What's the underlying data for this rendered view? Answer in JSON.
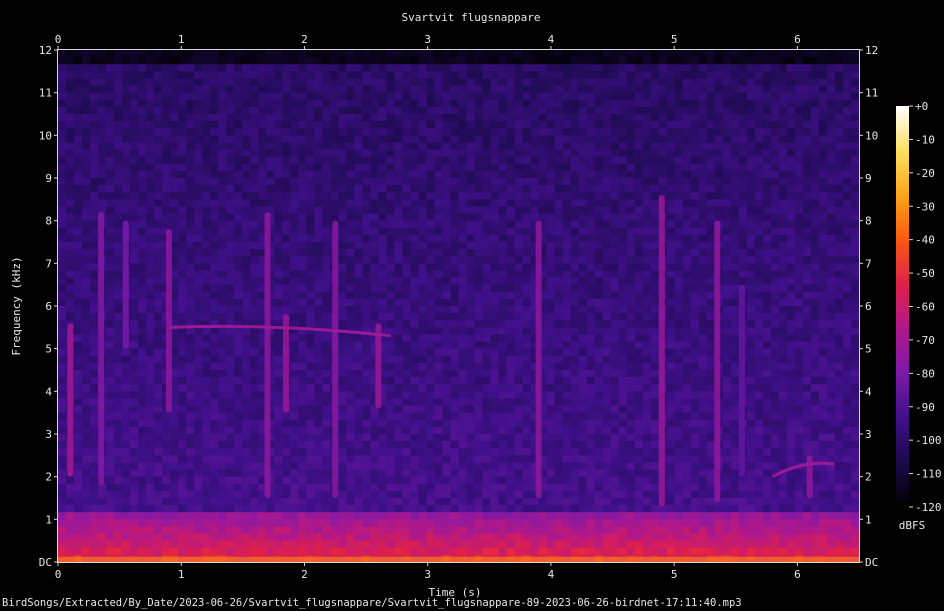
{
  "chart_data": {
    "type": "heatmap",
    "title": "Svartvit flugsnappare",
    "xlabel": "Time (s)",
    "ylabel": "Frequency (kHz)",
    "xlim": [
      0,
      6.5
    ],
    "ylim": [
      0,
      12
    ],
    "x_ticks": [
      "0",
      "1",
      "2",
      "3",
      "4",
      "5",
      "6"
    ],
    "y_ticks": [
      "DC",
      "1",
      "2",
      "3",
      "4",
      "5",
      "6",
      "7",
      "8",
      "9",
      "10",
      "11",
      "12"
    ],
    "colorbar": {
      "label": "dBFS",
      "range": [
        -120,
        0
      ],
      "ticks": [
        "+0",
        "-10",
        "-20",
        "-30",
        "-40",
        "-50",
        "-60",
        "-70",
        "-80",
        "-90",
        "-100",
        "-110",
        "-120"
      ],
      "colors": [
        "#000000",
        "#1a0a4a",
        "#40108a",
        "#7a1aa8",
        "#b0188a",
        "#e0204a",
        "#f85a10",
        "#fca51a",
        "#fde060",
        "#ffffff"
      ]
    },
    "spectral_content": {
      "background_level_dbfs": -100,
      "low_frequency_noise": {
        "f_max_khz": 1.1,
        "level_dbfs": -60,
        "peak_near_dc_dbfs": -30
      },
      "upper_cutoff_khz": 11.6,
      "calls": [
        {
          "t": 0.1,
          "f_low": 2.0,
          "f_high": 5.6,
          "level_dbfs": -70
        },
        {
          "t": 0.35,
          "f_low": 1.8,
          "f_high": 8.2,
          "level_dbfs": -78
        },
        {
          "t": 0.55,
          "f_low": 5.0,
          "f_high": 8.0,
          "level_dbfs": -80
        },
        {
          "t": 0.9,
          "f_low": 3.5,
          "f_high": 7.8,
          "level_dbfs": -75
        },
        {
          "t": 1.7,
          "f_low": 1.5,
          "f_high": 8.2,
          "level_dbfs": -75
        },
        {
          "t": 1.85,
          "f_low": 3.5,
          "f_high": 5.8,
          "level_dbfs": -72
        },
        {
          "t": 2.25,
          "f_low": 1.5,
          "f_high": 8.0,
          "level_dbfs": -76
        },
        {
          "t": 2.6,
          "f_low": 3.6,
          "f_high": 5.6,
          "level_dbfs": -72
        },
        {
          "t": 3.9,
          "f_low": 1.5,
          "f_high": 8.0,
          "level_dbfs": -75
        },
        {
          "t": 4.9,
          "f_low": 1.3,
          "f_high": 8.6,
          "level_dbfs": -72
        },
        {
          "t": 5.35,
          "f_low": 1.4,
          "f_high": 8.0,
          "level_dbfs": -74
        },
        {
          "t": 5.55,
          "f_low": 2.0,
          "f_high": 6.5,
          "level_dbfs": -85
        },
        {
          "t": 6.1,
          "f_low": 1.5,
          "f_high": 2.5,
          "level_dbfs": -74
        }
      ],
      "tones": [
        {
          "t_start": 0.9,
          "t_end": 2.7,
          "f_start": 5.5,
          "f_end": 5.3,
          "level_dbfs": -72
        },
        {
          "t_start": 5.8,
          "t_end": 6.3,
          "f_start": 2.0,
          "f_end": 2.3,
          "level_dbfs": -72
        }
      ]
    }
  },
  "file_path": "BirdSongs/Extracted/By_Date/2023-06-26/Svartvit_flugsnappare/Svartvit_flugsnappare-89-2023-06-26-birdnet-17:11:40.mp3"
}
